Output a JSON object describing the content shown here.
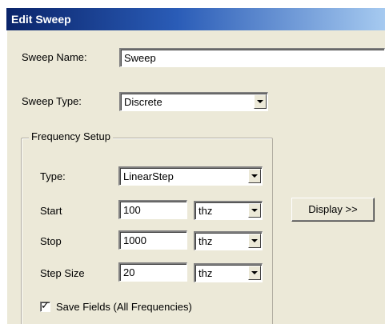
{
  "dialog": {
    "title": "Edit Sweep"
  },
  "sweep_name": {
    "label": "Sweep Name:",
    "value": "Sweep"
  },
  "sweep_type": {
    "label": "Sweep Type:",
    "value": "Discrete"
  },
  "frequency_setup": {
    "title": "Frequency Setup",
    "type": {
      "label": "Type:",
      "value": "LinearStep"
    },
    "start": {
      "label": "Start",
      "value": "100",
      "unit": "thz"
    },
    "stop": {
      "label": "Stop",
      "value": "1000",
      "unit": "thz"
    },
    "step_size": {
      "label": "Step Size",
      "value": "20",
      "unit": "thz"
    },
    "save_fields": {
      "label": "Save Fields (All Frequencies)",
      "checked": true
    }
  },
  "display_button": {
    "label": "Display >>"
  },
  "icons": {
    "dropdown": "chevron-down-icon",
    "check": "checkmark-icon"
  },
  "colors": {
    "titlebar_start": "#0a246a",
    "titlebar_end": "#a6caf0",
    "panel_bg": "#ece9d8"
  }
}
